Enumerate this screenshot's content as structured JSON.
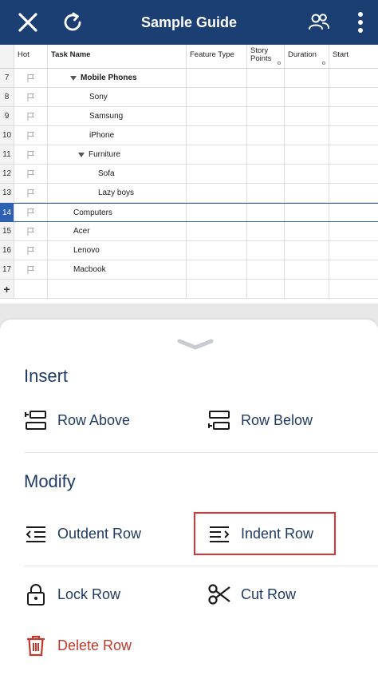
{
  "header": {
    "title": "Sample Guide",
    "bg_color": "#1c3f73",
    "close_icon": "close-icon",
    "refresh_icon": "refresh-icon",
    "people_icon": "people-icon",
    "more_icon": "more-vertical-icon"
  },
  "grid": {
    "columns": {
      "hot": "Hot",
      "task": "Task Name",
      "feature": "Feature Type",
      "story_line1": "Story",
      "story_line2": "Points",
      "duration": "Duration",
      "start": "Start"
    },
    "rows": [
      {
        "num": "7",
        "task": "Mobile Phones"
      },
      {
        "num": "8",
        "task": "Sony"
      },
      {
        "num": "9",
        "task": "Samsung"
      },
      {
        "num": "10",
        "task": "iPhone"
      },
      {
        "num": "11",
        "task": "Furniture"
      },
      {
        "num": "12",
        "task": "Sofa"
      },
      {
        "num": "13",
        "task": "Lazy boys"
      },
      {
        "num": "14",
        "task": "Computers"
      },
      {
        "num": "15",
        "task": "Acer"
      },
      {
        "num": "16",
        "task": "Lenovo"
      },
      {
        "num": "17",
        "task": "Macbook"
      }
    ],
    "add_row": "+",
    "selected_color": "#2d5fb3"
  },
  "sheet": {
    "insert_title": "Insert",
    "row_above": "Row Above",
    "row_below": "Row Below",
    "modify_title": "Modify",
    "outdent_row": "Outdent Row",
    "indent_row": "Indent Row",
    "lock_row": "Lock Row",
    "cut_row": "Cut Row",
    "delete_row": "Delete Row",
    "text_color": "#1f3b63",
    "danger_color": "#c0392b",
    "highlight_color": "#dd3333"
  }
}
